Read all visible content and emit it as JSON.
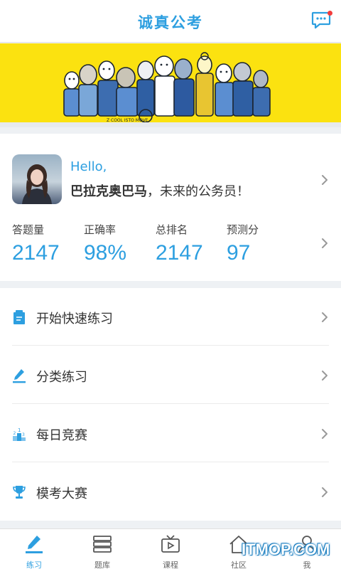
{
  "header": {
    "title": "诚真公考",
    "message_icon": "chat-bubble-icon",
    "has_notification": true
  },
  "banner": {
    "caption": "Z COOL ISTO MOVE"
  },
  "profile": {
    "hello": "Hello,",
    "name": "巴拉克奥巴马",
    "suffix": "，未来的公务员！",
    "stats": [
      {
        "label": "答题量",
        "value": "2147"
      },
      {
        "label": "正确率",
        "value": "98%"
      },
      {
        "label": "总排名",
        "value": "2147"
      },
      {
        "label": "预测分",
        "value": "97"
      }
    ]
  },
  "menu": [
    {
      "label": "开始快速练习",
      "icon": "quick-practice-icon"
    },
    {
      "label": "分类练习",
      "icon": "pen-icon"
    },
    {
      "label": "每日竞赛",
      "icon": "podium-icon"
    },
    {
      "label": "模考大赛",
      "icon": "trophy-icon"
    }
  ],
  "tabs": [
    {
      "label": "练习",
      "icon": "pen-icon",
      "active": true
    },
    {
      "label": "题库",
      "icon": "stack-icon"
    },
    {
      "label": "课程",
      "icon": "tv-play-icon"
    },
    {
      "label": "社区",
      "icon": "house-icon"
    },
    {
      "label": "我",
      "icon": "person-icon"
    }
  ],
  "watermark": "ITMOP.COM",
  "colors": {
    "accent": "#2d9fe0",
    "banner": "#fbe210",
    "badge": "#f23d3d"
  }
}
